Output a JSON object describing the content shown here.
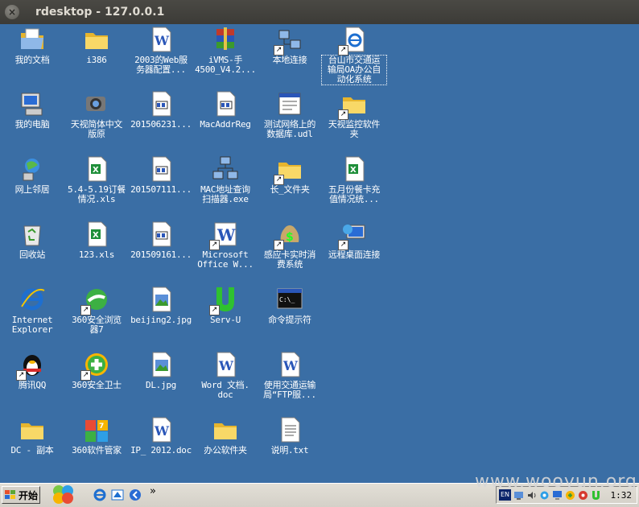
{
  "window": {
    "title": "rdesktop - 127.0.0.1",
    "close_label": "×"
  },
  "desktop_icons": [
    {
      "label": "我的文档",
      "icon": "folder-docs-icon"
    },
    {
      "label": "i386",
      "icon": "folder-icon"
    },
    {
      "label": "2003的Web服\n务器配置...",
      "icon": "word-doc-icon"
    },
    {
      "label": "iVMS-手\n4500_V4.2...",
      "icon": "winrar-icon"
    },
    {
      "label": "本地连接",
      "icon": "network-connection-icon"
    },
    {
      "label": "台山市交通运\n输局OA办公自\n动化系统",
      "icon": "ie-shortcut-icon"
    },
    {
      "label": "我的电脑",
      "icon": "my-computer-icon"
    },
    {
      "label": "天视简体中文\n版原",
      "icon": "camera-icon"
    },
    {
      "label": "201506231...",
      "icon": "text-file-icon"
    },
    {
      "label": "MacAddrReg",
      "icon": "text-file-icon"
    },
    {
      "label": "测试网络上的\n数据库.udl",
      "icon": "udl-file-icon"
    },
    {
      "label": "天视监控软件\n夹",
      "icon": "folder-icon"
    },
    {
      "label": "网上邻居",
      "icon": "network-places-icon"
    },
    {
      "label": "5.4-5.19订餐\n情况.xls",
      "icon": "excel-icon"
    },
    {
      "label": "201507111...",
      "icon": "text-file-icon"
    },
    {
      "label": "MAC地址查询\n扫描器.exe",
      "icon": "network-app-icon"
    },
    {
      "label": "长_文件夹",
      "icon": "folder-icon"
    },
    {
      "label": "五月份餐卡充\n值情况统...",
      "icon": "excel-icon"
    },
    {
      "label": "回收站",
      "icon": "recycle-bin-icon"
    },
    {
      "label": "123.xls",
      "icon": "excel-icon"
    },
    {
      "label": "201509161...",
      "icon": "text-file-icon"
    },
    {
      "label": "Microsoft\nOffice W...",
      "icon": "word-app-icon"
    },
    {
      "label": "感应卡实时消\n费系统",
      "icon": "money-bag-icon"
    },
    {
      "label": "远程桌面连接",
      "icon": "remote-desktop-icon"
    },
    {
      "label": "Internet\nExplorer",
      "icon": "internet-explorer-icon"
    },
    {
      "label": "360安全浏览\n器7",
      "icon": "360-browser-icon"
    },
    {
      "label": "beijing2.jpg",
      "icon": "image-file-icon"
    },
    {
      "label": "Serv-U",
      "icon": "servu-icon"
    },
    {
      "label": "命令提示符",
      "icon": "command-prompt-icon"
    },
    {
      "label": "腾讯QQ",
      "icon": "qq-penguin-icon"
    },
    {
      "label": "360安全卫士",
      "icon": "360-safeguard-icon"
    },
    {
      "label": "DL.jpg",
      "icon": "image-file-icon"
    },
    {
      "label": "Word 文档.\ndoc",
      "icon": "word-doc-icon"
    },
    {
      "label": "使用交通运输\n局“FTP服...",
      "icon": "word-doc-icon"
    },
    {
      "label": "DC - 副本",
      "icon": "folder-icon"
    },
    {
      "label": "360软件管家",
      "icon": "360-software-manager-icon"
    },
    {
      "label": "IP_ 2012.doc",
      "icon": "word-doc-icon"
    },
    {
      "label": "办公软件夹",
      "icon": "folder-icon"
    },
    {
      "label": "说明.txt",
      "icon": "notepad-file-icon"
    }
  ],
  "taskbar": {
    "start_label": "开始",
    "quick_launch_more": "»",
    "tray_lang": "EN",
    "clock": "1:32"
  },
  "watermark": "www.wooyun.org",
  "colors": {
    "desktop": "#3a6ea5",
    "taskbar": "#d4d0c8"
  }
}
